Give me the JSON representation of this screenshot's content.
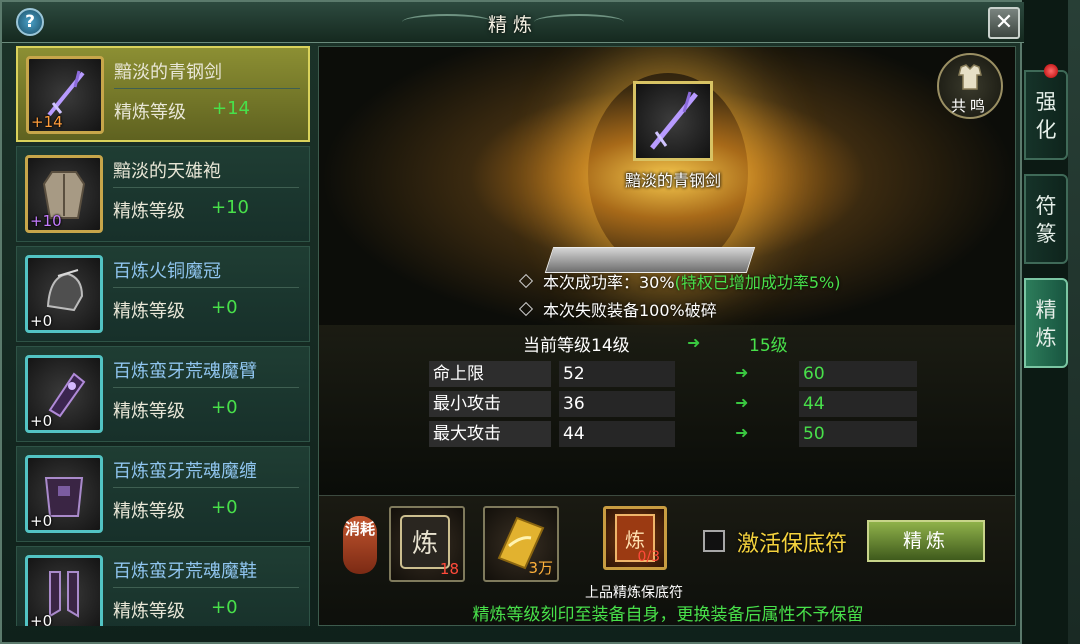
{
  "window": {
    "title": "精炼",
    "help_icon": "?",
    "close_icon": "✕"
  },
  "equipment": [
    {
      "name": "黯淡的青钢剑",
      "level_label": "精炼等级",
      "level_value": "+14",
      "badge": "+14",
      "icon": "sword-icon",
      "selected": true
    },
    {
      "name": "黯淡的天雄袍",
      "level_label": "精炼等级",
      "level_value": "+10",
      "badge": "+10",
      "icon": "robe-icon",
      "selected": false
    },
    {
      "name": "百炼火铜魔冠",
      "level_label": "精炼等级",
      "level_value": "+0",
      "badge": "+0",
      "icon": "helmet-icon",
      "selected": false
    },
    {
      "name": "百炼蛮牙荒魂魔臂",
      "level_label": "精炼等级",
      "level_value": "+0",
      "badge": "+0",
      "icon": "bracer-icon",
      "selected": false
    },
    {
      "name": "百炼蛮牙荒魂魔缠",
      "level_label": "精炼等级",
      "level_value": "+0",
      "badge": "+0",
      "icon": "belt-icon",
      "selected": false
    },
    {
      "name": "百炼蛮牙荒魂魔鞋",
      "level_label": "精炼等级",
      "level_value": "+0",
      "badge": "+0",
      "icon": "boots-icon",
      "selected": false
    }
  ],
  "target": {
    "name": "黯淡的青钢剑",
    "resonance_label": "共鸣",
    "success_prefix": "本次成功率：30%",
    "success_bonus": "(特权已增加成功率5%)",
    "fail_text": "本次失败装备100%破碎"
  },
  "levels": {
    "current": "当前等级14级",
    "next": "15级"
  },
  "stats": [
    {
      "label": "命上限",
      "current": "52",
      "next": "60"
    },
    {
      "label": "最小攻击",
      "current": "36",
      "next": "44"
    },
    {
      "label": "最大攻击",
      "current": "44",
      "next": "50"
    }
  ],
  "consume": {
    "tag": "消耗",
    "materials": [
      {
        "icon": "refine-stone-icon",
        "count": "18"
      },
      {
        "icon": "gold-ingot-icon",
        "count": "3万"
      }
    ],
    "guard": {
      "icon": "guard-charm-icon",
      "count": "0/3",
      "name": "上品精炼保底符"
    },
    "activate_label": "激活保底符",
    "refine_button": "精炼",
    "note": "精炼等级刻印至装备自身，更换装备后属性不予保留"
  },
  "side_tabs": [
    {
      "label": "强化",
      "active": false
    },
    {
      "label": "符篆",
      "active": false
    },
    {
      "label": "精炼",
      "active": true
    }
  ]
}
